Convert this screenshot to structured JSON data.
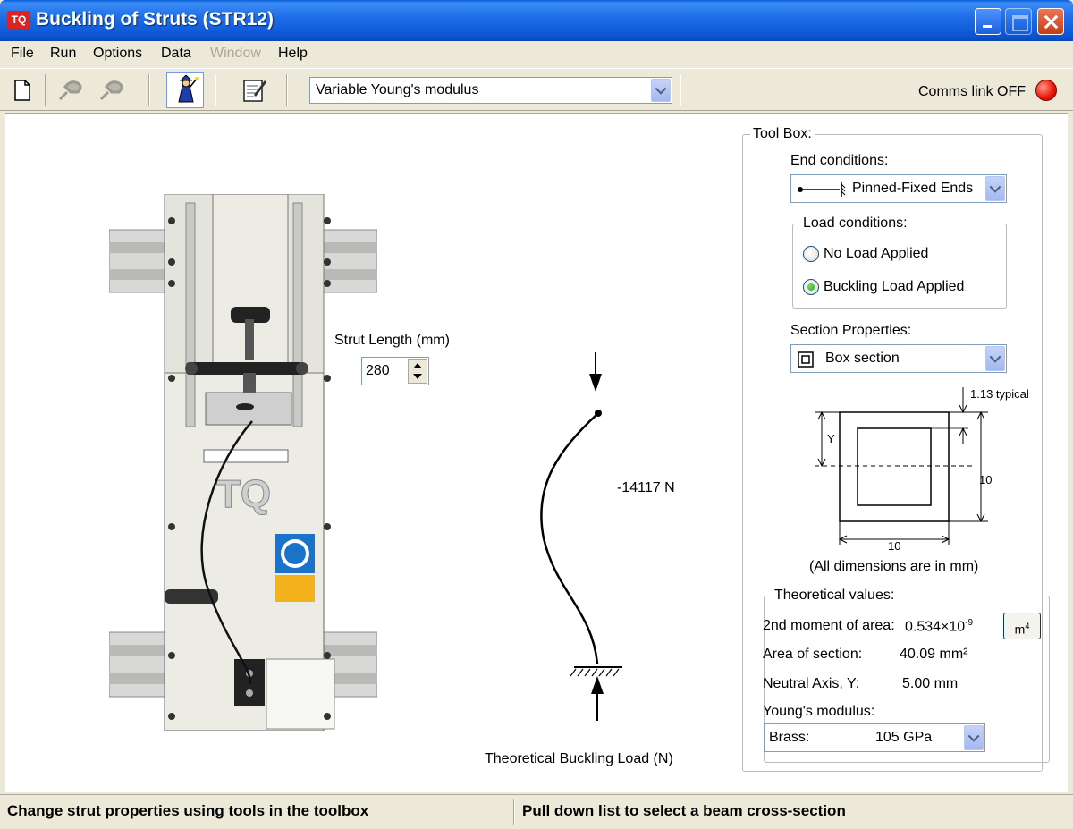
{
  "window": {
    "title": "Buckling of Struts (STR12)",
    "icon_text": "TQ"
  },
  "menu": [
    "File",
    "Run",
    "Options",
    "Data",
    "Window",
    "Help"
  ],
  "toolbar": {
    "mode_select": "Variable Young's modulus",
    "comms_label": "Comms link OFF",
    "comms_color": "#e81c0c"
  },
  "apparatus": {
    "strut_length_label": "Strut Length (mm)",
    "strut_length_value": "280"
  },
  "diagram": {
    "load_value": "-14117 N",
    "caption": "Theoretical Buckling Load (N)"
  },
  "toolbox": {
    "title": "Tool Box:",
    "end_conditions_label": "End conditions:",
    "end_conditions_value": "Pinned-Fixed Ends",
    "load_conditions_title": "Load conditions:",
    "load_options": [
      {
        "label": "No Load Applied",
        "checked": false
      },
      {
        "label": "Buckling Load Applied",
        "checked": true
      }
    ],
    "section_properties_label": "Section Properties:",
    "section_value": "Box section",
    "section_drawing": {
      "wall_label": "1.13 typical",
      "y_label": "Y",
      "height_label": "10",
      "width_label": "10"
    },
    "dims_note": "(All dimensions are in mm)"
  },
  "theoretical": {
    "title": "Theoretical values:",
    "moment_label": "2nd moment of area:",
    "moment_value": "0.534×10",
    "moment_exp": "-9",
    "units_button": "m",
    "units_button_exp": "4",
    "area_label": "Area of section:",
    "area_value": "40.09 mm²",
    "neutral_label": "Neutral Axis, Y:",
    "neutral_value": "5.00 mm",
    "youngs_label": "Young's modulus:",
    "material": "Brass:",
    "material_modulus": "105 GPa"
  },
  "status": {
    "left": "Change strut properties using tools in the toolbox",
    "right": "Pull down list to select a beam cross-section"
  }
}
